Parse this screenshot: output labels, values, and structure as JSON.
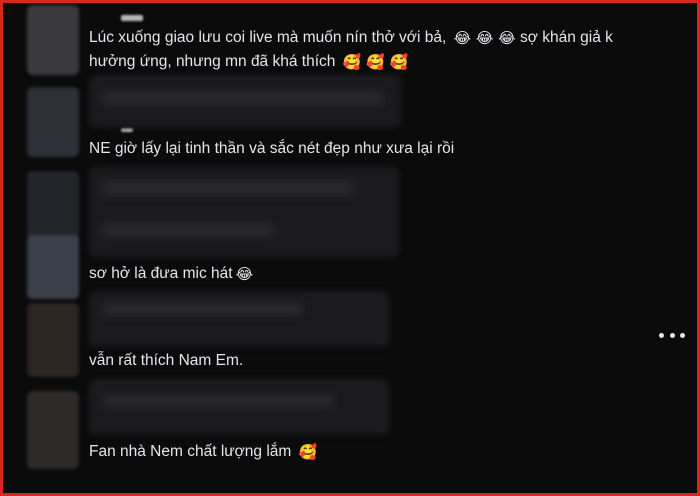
{
  "comments": [
    {
      "text": "Lúc xuống giao lưu coi live mà muốn nín thở với bả,",
      "emoji_a": "😂 😂 😂",
      "text2": "sợ khán giả k",
      "line2": "hưởng ứng, nhưng mn đã khá thích",
      "emoji_b": "🥰 🥰 🥰"
    },
    {
      "text": "NE giờ lấy lại tinh thần và sắc nét đẹp như xưa lại rồi"
    },
    {
      "text": "sơ hở là đưa mic hát",
      "emoji": "😂"
    },
    {
      "text": "vẫn rất thích Nam Em."
    },
    {
      "text": "Fan nhà Nem chất lượng lắm",
      "emoji": "🥰"
    }
  ],
  "more_icon": "more-horizontal-icon",
  "colors": {
    "border": "#d7281f",
    "text": "#e4e6eb",
    "background": "#0b0b0c"
  }
}
